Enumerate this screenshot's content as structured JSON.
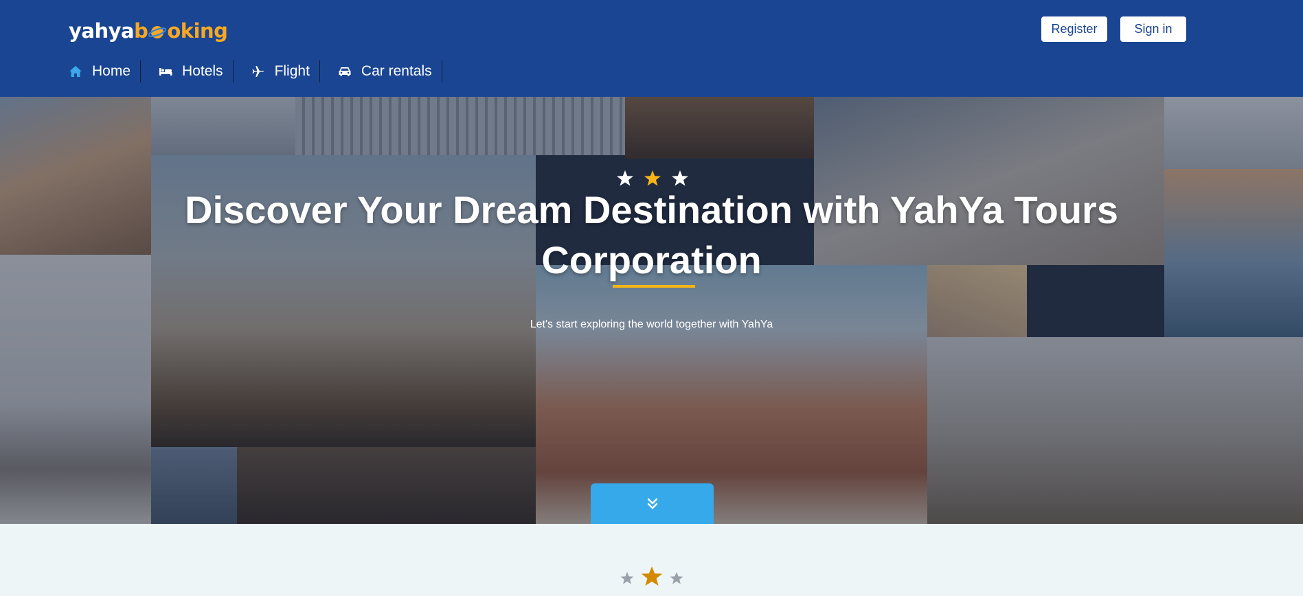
{
  "brand": {
    "logo_text_left": "yahya",
    "logo_text_right": "oking",
    "logo_text_b": "b"
  },
  "auth": {
    "register_label": "Register",
    "signin_label": "Sign in"
  },
  "nav": {
    "items": [
      {
        "label": "Home",
        "icon": "home-icon"
      },
      {
        "label": "Hotels",
        "icon": "bed-icon"
      },
      {
        "label": "Flight",
        "icon": "plane-icon"
      },
      {
        "label": "Car rentals",
        "icon": "car-icon"
      }
    ]
  },
  "hero": {
    "title": "Discover Your Dream Destination with YahYa Tours Corporation",
    "subtitle": "Let's start exploring the world together with YahYa",
    "scroll_icon": "double-chevron-down-icon"
  },
  "colors": {
    "header_bg": "#1a4592",
    "accent": "#f7a823",
    "button_blue": "#36a9ea",
    "section_bg": "#eef5f7"
  }
}
